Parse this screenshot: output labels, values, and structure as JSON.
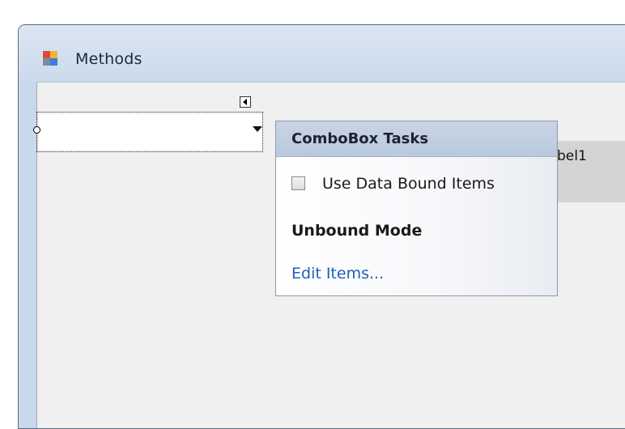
{
  "window": {
    "title": "Methods",
    "icon": "form-app-icon"
  },
  "designer": {
    "combobox": {
      "value": "",
      "icon": "dropdown-arrow-icon"
    },
    "label": {
      "text": "bel1"
    }
  },
  "tasks_panel": {
    "title": "ComboBox Tasks",
    "use_data_bound_items": {
      "label": "Use Data Bound Items",
      "checked": false
    },
    "section_title": "Unbound Mode",
    "edit_items_link": "Edit Items..."
  }
}
